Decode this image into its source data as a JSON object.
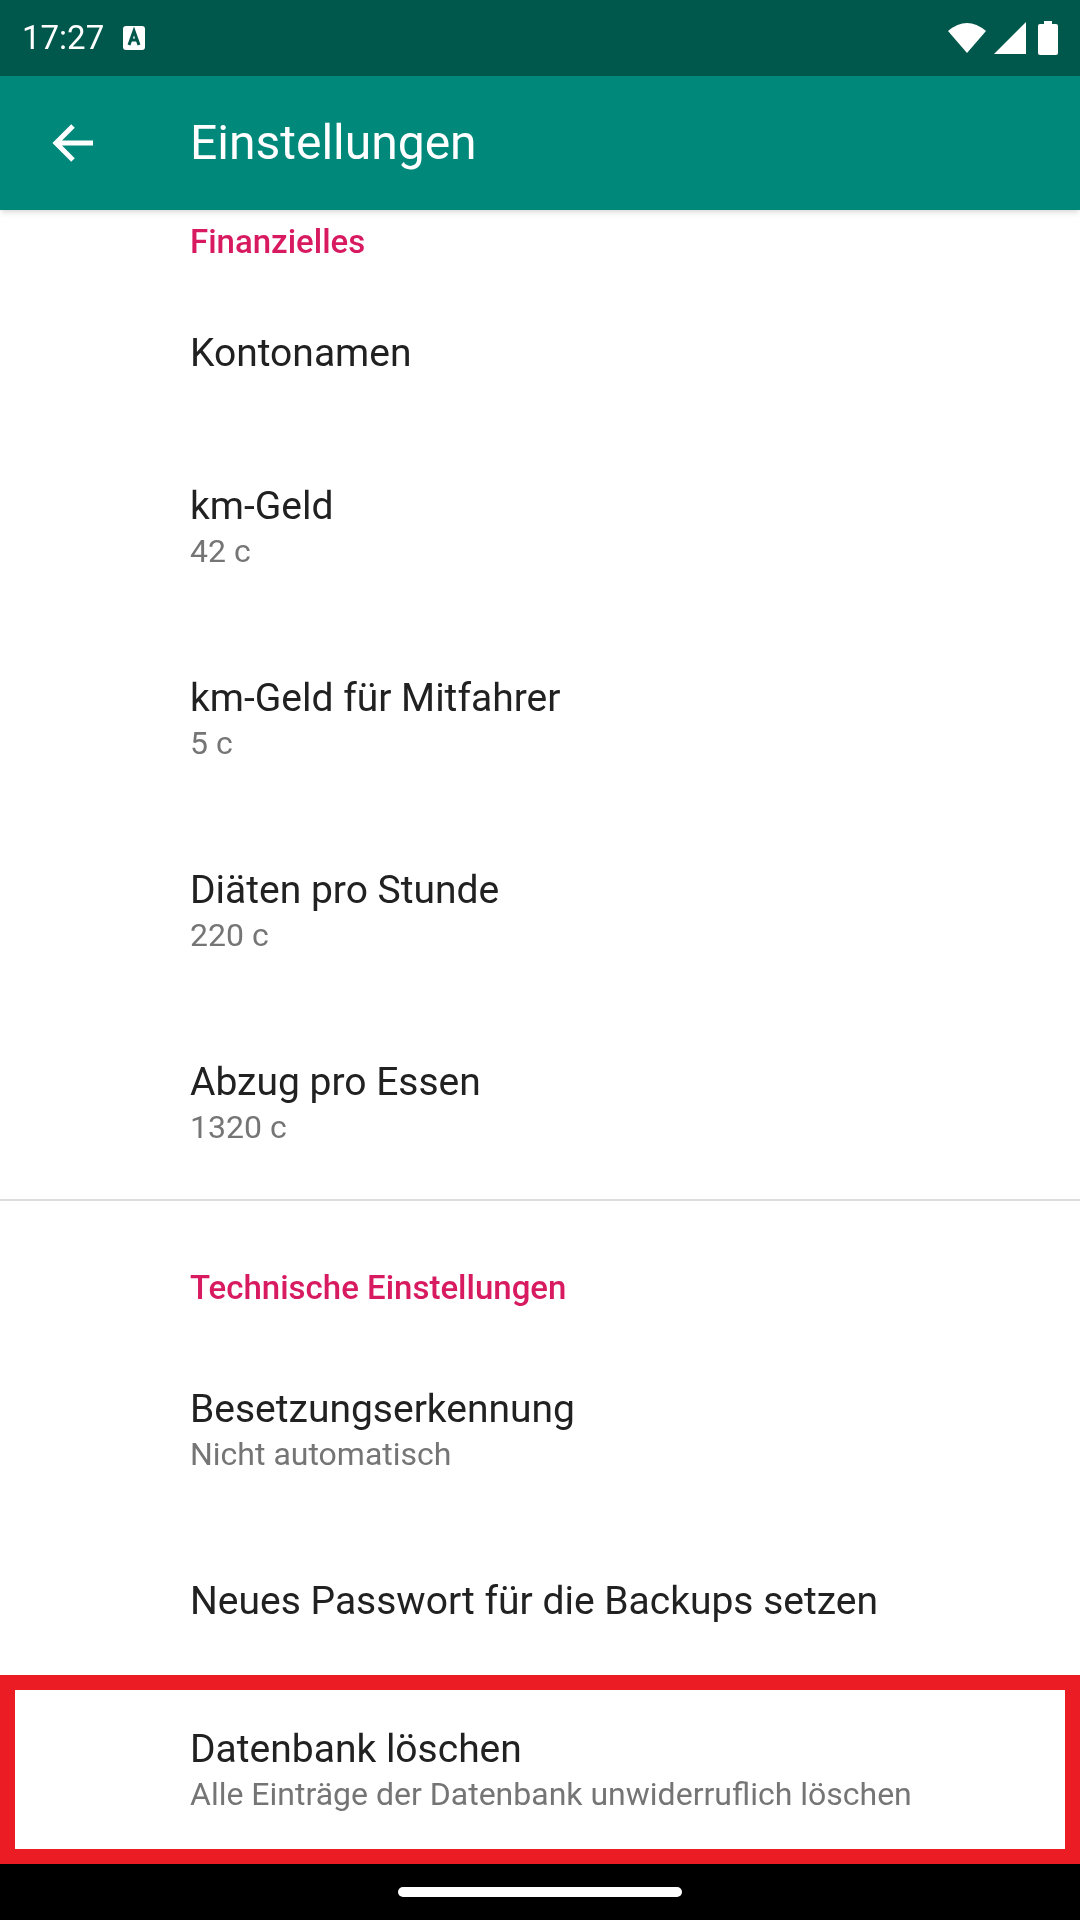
{
  "status_bar": {
    "time": "17:27"
  },
  "toolbar": {
    "title": "Einstellungen"
  },
  "sections": [
    {
      "header": "Finanzielles",
      "items": [
        {
          "title": "Kontonamen",
          "highlighted": false
        },
        {
          "title": "km-Geld",
          "summary": "42 c",
          "highlighted": false
        },
        {
          "title": "km-Geld für Mitfahrer",
          "summary": "5 c",
          "highlighted": false
        },
        {
          "title": "Diäten pro Stunde",
          "summary": "220 c",
          "highlighted": false
        },
        {
          "title": "Abzug pro Essen",
          "summary": "1320 c",
          "highlighted": false
        }
      ]
    },
    {
      "header": "Technische Einstellungen",
      "items": [
        {
          "title": "Besetzungserkennung",
          "summary": "Nicht automatisch",
          "highlighted": false
        },
        {
          "title": "Neues Passwort für die Backups setzen",
          "highlighted": false
        },
        {
          "title": "Datenbank löschen",
          "summary": "Alle Einträge der Datenbank unwiderruflich löschen",
          "highlighted": true
        }
      ]
    }
  ]
}
